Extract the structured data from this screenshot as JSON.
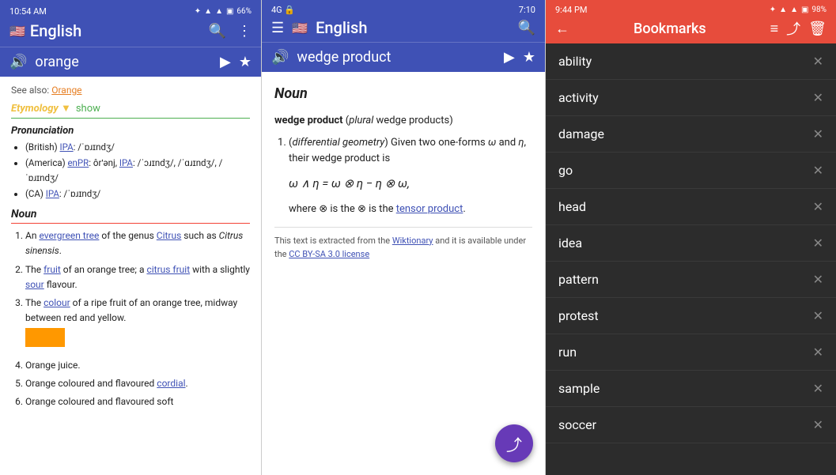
{
  "panel1": {
    "status_time": "10:54 AM",
    "status_battery": "66%",
    "title": "English",
    "search_icon": "🔍",
    "more_icon": "⋮",
    "word": "orange",
    "play_icon": "▶",
    "star_icon": "★",
    "see_also_prefix": "See also: ",
    "see_also_link": "Orange",
    "etymology_label": "Etymology ▼",
    "etymology_toggle": "show",
    "pronunciation_heading": "Pronunciation",
    "pron_items": [
      "(British) IPA: /ˈɒɹɪndʒ/",
      "(America) enPR: ôrʹənj, IPA: /ˈɔɹɪndʒ/, /ˈɑɹɪndʒ/, /ˈɒɹɪndʒ/",
      "(CA) IPA: /ˈɒɹɪndʒ/"
    ],
    "noun_heading": "Noun",
    "noun_items": [
      "An evergreen tree of the genus Citrus such as Citrus sinensis.",
      "The fruit of an orange tree; a citrus fruit with a slightly sour flavour.",
      "The colour of a ripe fruit of an orange tree, midway between red and yellow.",
      "Orange juice.",
      "Orange coloured and flavoured cordial.",
      "Orange coloured and flavoured soft"
    ]
  },
  "panel2": {
    "status_time": "7:10",
    "status_4g": "4G",
    "title": "English",
    "word": "wedge product",
    "noun_heading": "Noun",
    "definition_term": "wedge product",
    "definition_plural": "plural",
    "definition_plural_word": "wedge products",
    "definition_1_label": "differential geometry",
    "definition_1_text": "Given two one-forms ω and η, their wedge product is",
    "formula": "ω ∧ η = ω ⊗ η − η ⊗ ω,",
    "where_text": "where ⊗ is the",
    "where_link": "tensor product",
    "where_end": ".",
    "wiktionary_text": "This text is extracted from the",
    "wiktionary_link": "Wiktionary",
    "wiktionary_mid": "and it is available under the",
    "cc_link": "CC BY-SA 3.0 license",
    "share_icon": "share"
  },
  "panel3": {
    "status_time": "9:44 PM",
    "status_battery": "98%",
    "title": "Bookmarks",
    "back_icon": "←",
    "sort_icon": "≡",
    "share_icon": "⤴",
    "delete_icon": "🗑",
    "items": [
      "ability",
      "activity",
      "damage",
      "go",
      "head",
      "idea",
      "pattern",
      "protest",
      "run",
      "sample",
      "soccer"
    ]
  }
}
